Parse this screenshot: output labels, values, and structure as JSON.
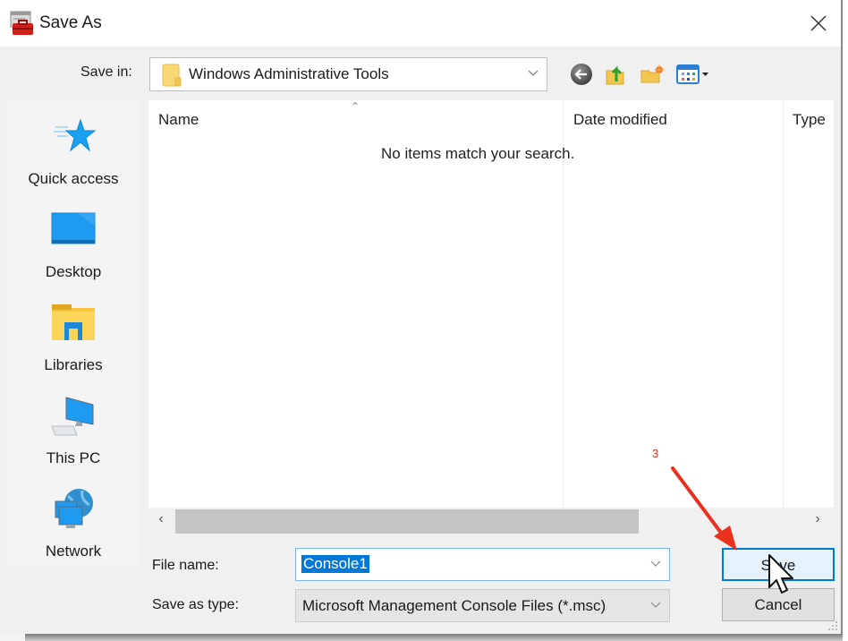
{
  "window": {
    "title": "Save As",
    "icon": "mmc-toolbox-icon",
    "close_icon": "close-icon"
  },
  "save_in": {
    "label": "Save in:",
    "value": "Windows Administrative Tools",
    "folder_icon": "folder-icon"
  },
  "toolbar": {
    "buttons": [
      {
        "name": "back",
        "icon": "back-arrow-icon"
      },
      {
        "name": "up-one-level",
        "icon": "folder-up-icon"
      },
      {
        "name": "new-folder",
        "icon": "new-folder-icon"
      },
      {
        "name": "view-menu",
        "icon": "view-menu-icon"
      }
    ]
  },
  "places": [
    {
      "label": "Quick access",
      "icon": "star-icon"
    },
    {
      "label": "Desktop",
      "icon": "desktop-icon"
    },
    {
      "label": "Libraries",
      "icon": "libraries-icon"
    },
    {
      "label": "This PC",
      "icon": "computer-icon"
    },
    {
      "label": "Network",
      "icon": "network-icon"
    }
  ],
  "file_list": {
    "columns": [
      "Name",
      "Date modified",
      "Type"
    ],
    "sorted_column": "Name",
    "empty_message": "No items match your search."
  },
  "file_name": {
    "label": "File name:",
    "value": "Console1"
  },
  "save_as_type": {
    "label": "Save as type:",
    "value": "Microsoft Management Console Files (*.msc)"
  },
  "buttons": {
    "save": "Save",
    "cancel": "Cancel"
  },
  "annotation": {
    "step_number": "3",
    "color": "#e8321e"
  },
  "colors": {
    "accent": "#0078d7",
    "dialog_bg": "#f0f0f0"
  }
}
